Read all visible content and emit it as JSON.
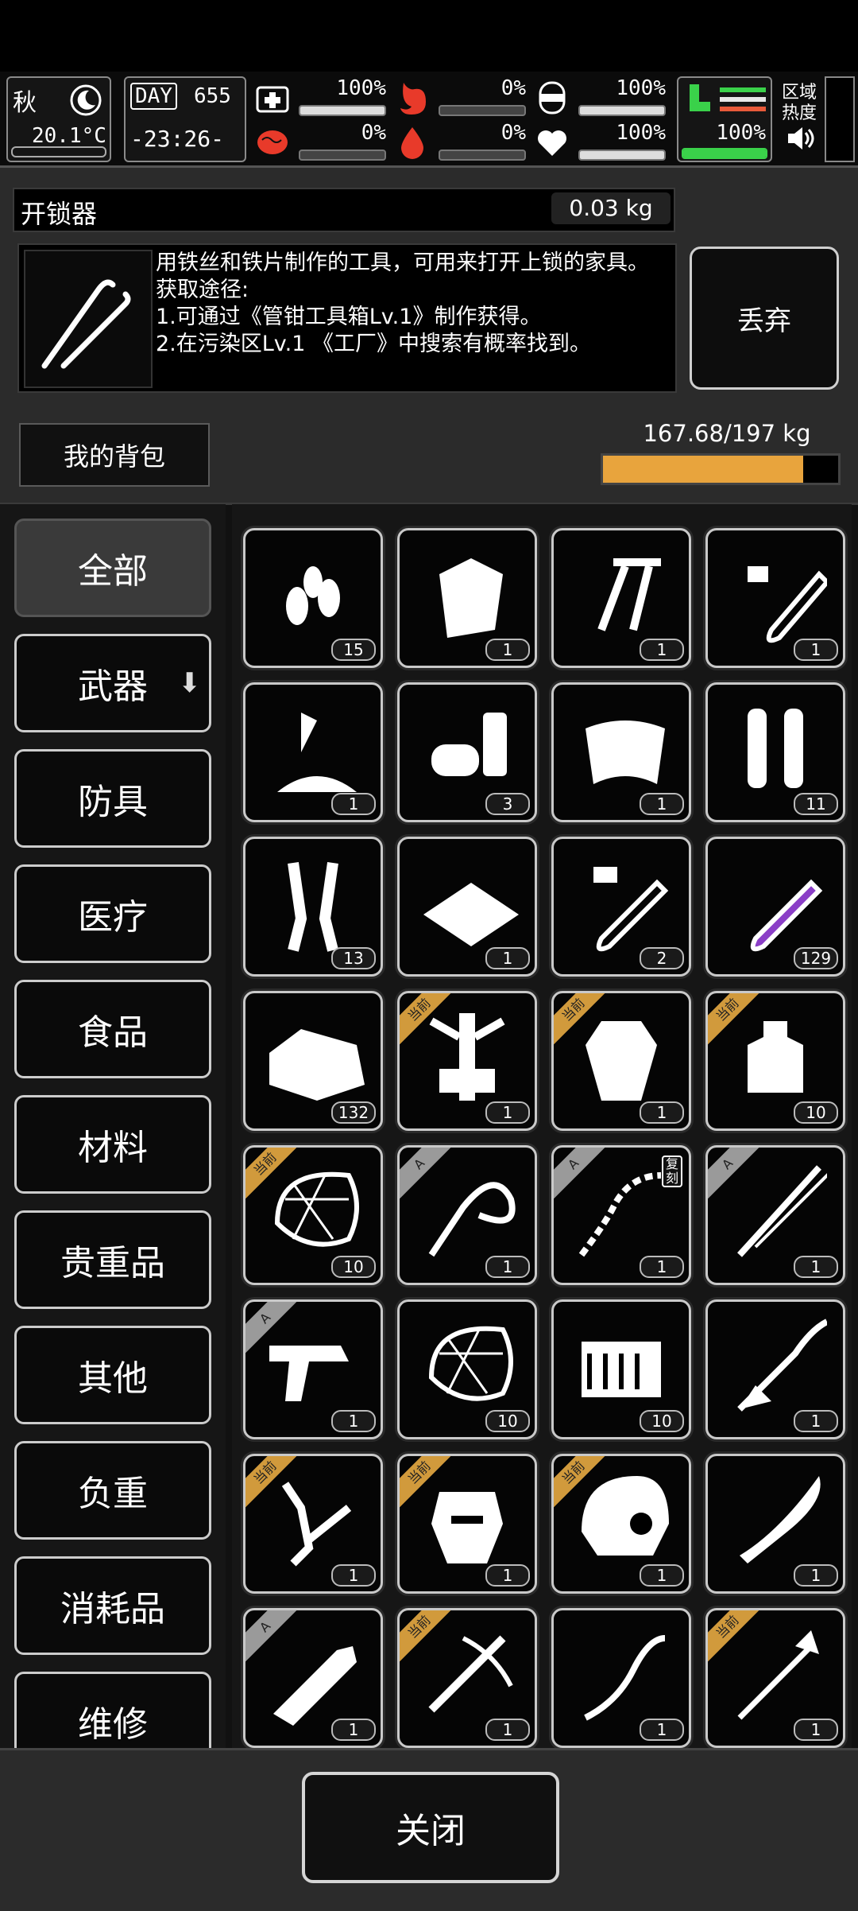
{
  "hud": {
    "season": "秋",
    "temperature": "20.1°C",
    "day_label": "DAY",
    "day_number": "655",
    "time": "-23:26-",
    "stats": [
      {
        "icon": "medkit-icon",
        "value": "100%",
        "level": 1.0
      },
      {
        "icon": "stomach-icon",
        "value": "0%",
        "level": 0.0,
        "color": "#e83a2a"
      },
      {
        "icon": "bandage-icon",
        "value": "100%",
        "level": 1.0
      },
      {
        "icon": "brain-icon",
        "value": "0%",
        "level": 0.0,
        "color": "#e83a2a"
      },
      {
        "icon": "blood-drop-icon",
        "value": "0%",
        "level": 0.0,
        "color": "#e83a2a"
      },
      {
        "icon": "heart-icon",
        "value": "100%",
        "level": 1.0
      }
    ],
    "stamina": {
      "icon": "boot-icon",
      "value": "100%",
      "level": 1.0,
      "color": "#3ad14a"
    },
    "region_heat_label": "区域热度"
  },
  "item": {
    "name": "开锁器",
    "weight": "0.03 kg",
    "description": [
      "用铁丝和铁片制作的工具，可用来打开上锁的家具。",
      "获取途径:",
      "1.可通过《管钳工具箱Lv.1》制作获得。",
      "2.在污染区Lv.1 《工厂》中搜索有概率找到。"
    ],
    "discard_label": "丢弃"
  },
  "bag": {
    "label": "我的背包",
    "weight": "167.68/197 kg",
    "fill_fraction": 0.851,
    "fill_color": "#e8a43d"
  },
  "categories": [
    {
      "label": "全部",
      "active": true
    },
    {
      "label": "武器",
      "active": false,
      "arrow": "⬇"
    },
    {
      "label": "防具",
      "active": false
    },
    {
      "label": "医疗",
      "active": false
    },
    {
      "label": "食品",
      "active": false
    },
    {
      "label": "材料",
      "active": false
    },
    {
      "label": "贵重品",
      "active": false
    },
    {
      "label": "其他",
      "active": false
    },
    {
      "label": "负重",
      "active": false
    },
    {
      "label": "消耗品",
      "active": false
    },
    {
      "label": "维修",
      "active": false
    }
  ],
  "tags": {
    "current": "当前",
    "grade_a": "A",
    "copy_badge": "复刻"
  },
  "items": [
    {
      "icon": "bullets-icon",
      "count": "15"
    },
    {
      "icon": "cloth-bag-icon",
      "count": "1"
    },
    {
      "icon": "screws-icon",
      "count": "1"
    },
    {
      "icon": "test-tube-i-icon",
      "count": "1"
    },
    {
      "icon": "powder-pile-icon",
      "count": "1"
    },
    {
      "icon": "cans-icon",
      "count": "3"
    },
    {
      "icon": "cloth-sheet-icon",
      "count": "1"
    },
    {
      "icon": "cylinders-icon",
      "count": "11"
    },
    {
      "icon": "ampoules-icon",
      "count": "13"
    },
    {
      "icon": "tray-icon",
      "count": "1"
    },
    {
      "icon": "test-tube-iv-icon",
      "count": "2"
    },
    {
      "icon": "purple-potion-icon",
      "count": "129"
    },
    {
      "icon": "rock-chunk-icon",
      "count": "132"
    },
    {
      "icon": "machine-part-icon",
      "count": "1",
      "tag": "current"
    },
    {
      "icon": "vest-plate-icon",
      "count": "1",
      "tag": "current"
    },
    {
      "icon": "canister-icon",
      "count": "10",
      "tag": "current"
    },
    {
      "icon": "net-helmet-icon",
      "count": "10",
      "tag": "current"
    },
    {
      "icon": "whip-icon",
      "count": "1",
      "tag": "grade_a"
    },
    {
      "icon": "chain-icon",
      "count": "1",
      "tag": "grade_a",
      "copy": true
    },
    {
      "icon": "katana-icon",
      "count": "1",
      "tag": "grade_a"
    },
    {
      "icon": "pistol-icon",
      "count": "1",
      "tag": "grade_a"
    },
    {
      "icon": "net-helmet-icon",
      "count": "10"
    },
    {
      "icon": "ammo-box-icon",
      "count": "10"
    },
    {
      "icon": "tentacle-staff-icon",
      "count": "1"
    },
    {
      "icon": "mech-arm-icon",
      "count": "1",
      "tag": "current"
    },
    {
      "icon": "armor-mask-icon",
      "count": "1",
      "tag": "current"
    },
    {
      "icon": "tactical-helmet-icon",
      "count": "1",
      "tag": "current"
    },
    {
      "icon": "knife-icon",
      "count": "1"
    },
    {
      "icon": "machete-icon",
      "count": "1",
      "tag": "grade_a"
    },
    {
      "icon": "crossbow-icon",
      "count": "1",
      "tag": "current"
    },
    {
      "icon": "curved-blade-icon",
      "count": "1"
    },
    {
      "icon": "spear-icon",
      "count": "1",
      "tag": "current"
    }
  ],
  "close_label": "关闭"
}
